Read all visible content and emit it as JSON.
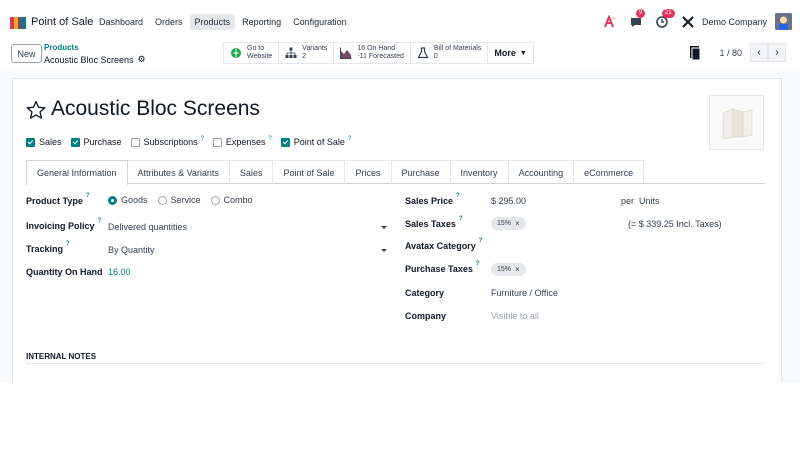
{
  "app": {
    "name": "Point of Sale",
    "brand_color": "#714b67",
    "accent_color": "#017e84"
  },
  "menu": [
    {
      "label": "Dashboard",
      "active": false
    },
    {
      "label": "Orders",
      "active": false
    },
    {
      "label": "Products",
      "active": true
    },
    {
      "label": "Reporting",
      "active": false
    },
    {
      "label": "Configuration",
      "active": false
    }
  ],
  "nav_right": {
    "messages_badge": "9",
    "activities_badge": "21",
    "company": "Demo Company"
  },
  "control": {
    "new_label": "New",
    "breadcrumb_parent": "Products",
    "breadcrumb_current": "Acoustic Bloc Screens",
    "pager": "1 / 80"
  },
  "smart_buttons": {
    "website_line1": "Go to",
    "website_line2": "Website",
    "variants_line1": "Variants",
    "variants_line2": "2",
    "onhand_line1": "16 On Hand",
    "onhand_line2": "-11 Forecasted",
    "bom_line1": "Bill of Materials",
    "bom_line2": "0",
    "more": "More"
  },
  "product": {
    "title": "Acoustic Bloc Screens"
  },
  "checkboxes": [
    {
      "label": "Sales",
      "checked": true,
      "help": false
    },
    {
      "label": "Purchase",
      "checked": true,
      "help": false
    },
    {
      "label": "Subscriptions",
      "checked": false,
      "help": true
    },
    {
      "label": "Expenses",
      "checked": false,
      "help": true
    },
    {
      "label": "Point of Sale",
      "checked": true,
      "help": true
    }
  ],
  "help_mark": "?",
  "tabs": [
    "General Information",
    "Attributes & Variants",
    "Sales",
    "Point of Sale",
    "Prices",
    "Purchase",
    "Inventory",
    "Accounting",
    "eCommerce"
  ],
  "left_fields": {
    "product_type_label": "Product Type",
    "product_type_options": [
      "Goods",
      "Service",
      "Combo"
    ],
    "product_type_selected": "Goods",
    "invoicing_label": "Invoicing Policy",
    "invoicing_value": "Delivered quantities",
    "tracking_label": "Tracking",
    "tracking_value": "By Quantity",
    "qty_label": "Quantity On Hand",
    "qty_value": "16.00"
  },
  "right_fields": {
    "sales_price_label": "Sales Price",
    "sales_price_value": "$ 295.00",
    "per_label": "per",
    "unit_value": "Units",
    "sales_taxes_label": "Sales Taxes",
    "sales_tax_tag": "15%",
    "incl_taxes": "(= $ 339.25 Incl. Taxes)",
    "avatax_label": "Avatax Category",
    "purchase_taxes_label": "Purchase Taxes",
    "purchase_tax_tag": "15%",
    "category_label": "Category",
    "category_value": "Furniture / Office",
    "company_label": "Company",
    "company_placeholder": "Visible to all"
  },
  "notes": {
    "label": "INTERNAL NOTES"
  }
}
